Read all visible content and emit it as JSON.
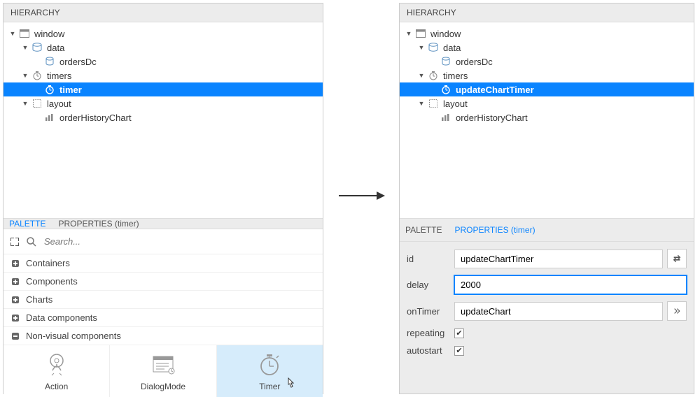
{
  "left": {
    "hierarchy_title": "HIERARCHY",
    "tree": [
      {
        "label": "window",
        "indent": 0,
        "caret": true,
        "icon": "window-icon",
        "selected": false
      },
      {
        "label": "data",
        "indent": 1,
        "caret": true,
        "icon": "data-icon",
        "selected": false
      },
      {
        "label": "ordersDc",
        "indent": 2,
        "caret": false,
        "icon": "datasource-icon",
        "selected": false
      },
      {
        "label": "timers",
        "indent": 1,
        "caret": true,
        "icon": "timers-icon",
        "selected": false
      },
      {
        "label": "timer",
        "indent": 2,
        "caret": false,
        "icon": "timer-icon",
        "selected": true
      },
      {
        "label": "layout",
        "indent": 1,
        "caret": true,
        "icon": "layout-icon",
        "selected": false
      },
      {
        "label": "orderHistoryChart",
        "indent": 2,
        "caret": false,
        "icon": "chart-icon",
        "selected": false
      }
    ],
    "tabs": {
      "palette": "PALETTE",
      "properties": "PROPERTIES (timer)"
    },
    "search": {
      "placeholder": "Search..."
    },
    "categories": [
      {
        "label": "Containers",
        "expanded": false
      },
      {
        "label": "Components",
        "expanded": false
      },
      {
        "label": "Charts",
        "expanded": false
      },
      {
        "label": "Data components",
        "expanded": false
      },
      {
        "label": "Non-visual components",
        "expanded": true
      }
    ],
    "palette_items": [
      {
        "label": "Action",
        "icon": "action-icon",
        "hover": false
      },
      {
        "label": "DialogMode",
        "icon": "dialogmode-icon",
        "hover": false
      },
      {
        "label": "Timer",
        "icon": "timer-large-icon",
        "hover": true
      }
    ]
  },
  "right": {
    "hierarchy_title": "HIERARCHY",
    "tree": [
      {
        "label": "window",
        "indent": 0,
        "caret": true,
        "icon": "window-icon",
        "selected": false
      },
      {
        "label": "data",
        "indent": 1,
        "caret": true,
        "icon": "data-icon",
        "selected": false
      },
      {
        "label": "ordersDc",
        "indent": 2,
        "caret": false,
        "icon": "datasource-icon",
        "selected": false
      },
      {
        "label": "timers",
        "indent": 1,
        "caret": true,
        "icon": "timers-icon",
        "selected": false
      },
      {
        "label": "updateChartTimer",
        "indent": 2,
        "caret": false,
        "icon": "timer-icon",
        "selected": true
      },
      {
        "label": "layout",
        "indent": 1,
        "caret": true,
        "icon": "layout-icon",
        "selected": false
      },
      {
        "label": "orderHistoryChart",
        "indent": 2,
        "caret": false,
        "icon": "chart-icon",
        "selected": false
      }
    ],
    "tabs": {
      "palette": "PALETTE",
      "properties": "PROPERTIES (timer)"
    },
    "properties": {
      "id": {
        "label": "id",
        "value": "updateChartTimer"
      },
      "delay": {
        "label": "delay",
        "value": "2000"
      },
      "onTimer": {
        "label": "onTimer",
        "value": "updateChart"
      },
      "repeating": {
        "label": "repeating",
        "checked": true
      },
      "autostart": {
        "label": "autostart",
        "checked": true
      }
    }
  }
}
